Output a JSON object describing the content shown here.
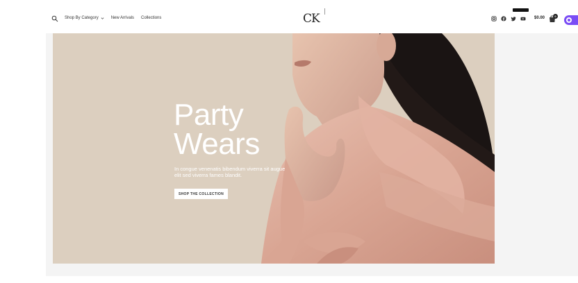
{
  "header": {
    "nav": [
      {
        "label": "Shop By Category",
        "has_dropdown": true
      },
      {
        "label": "New Arrivals",
        "has_dropdown": false
      },
      {
        "label": "Collections",
        "has_dropdown": false
      }
    ],
    "logo": "CK",
    "social_icons": [
      "instagram-icon",
      "facebook-icon",
      "twitter-icon",
      "youtube-icon"
    ],
    "cart_total": "$0.00",
    "cart_count": "0"
  },
  "hero": {
    "title_line1": "Party",
    "title_line2": "Wears",
    "subtitle": "In congue venenatis bibendum viverra sit augue elit sed viverra fames blandit.",
    "button_label": "SHOP THE COLLECTION",
    "background_color": "#dccfbf"
  },
  "colors": {
    "accent": "#7a4cf5",
    "text_dark": "#222222"
  }
}
